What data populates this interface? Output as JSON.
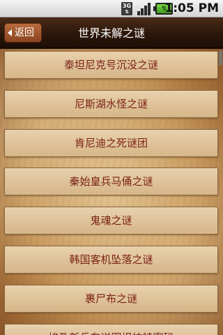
{
  "status_bar": {
    "time": "1:05 PM",
    "usb_label": "3G",
    "icons": [
      "usb-debug-icon",
      "signal-icon",
      "battery-icon"
    ]
  },
  "header": {
    "back_label": "返回",
    "title": "世界未解之谜"
  },
  "list": {
    "items": [
      "泰坦尼克号沉没之谜",
      "尼斯湖水怪之谜",
      "肯尼迪之死谜团",
      "秦始皇兵马俑之谜",
      "鬼魂之谜",
      "韩国客机坠落之谜",
      "裹尸布之谜",
      "埃及新兵车送图坦拉特密码"
    ]
  },
  "colors": {
    "item_text": "#7a1f14",
    "title_bar": "#2c170a",
    "back_button": "#a3582d"
  }
}
